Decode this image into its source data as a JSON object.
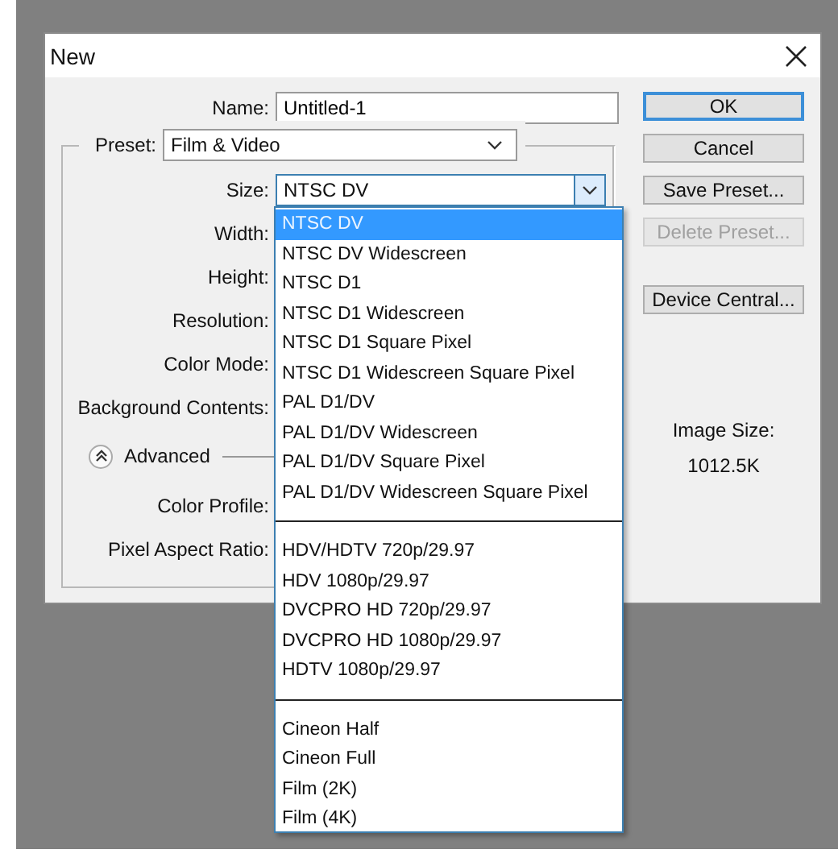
{
  "window": {
    "title": "New"
  },
  "name_field": {
    "label": "Name:",
    "value": "Untitled-1"
  },
  "preset": {
    "label": "Preset:",
    "value": "Film & Video"
  },
  "size": {
    "label": "Size:",
    "value": "NTSC DV",
    "expanded": true
  },
  "field_labels": [
    "Width:",
    "Height:",
    "Resolution:",
    "Color Mode:",
    "Background Contents:"
  ],
  "advanced": {
    "label": "Advanced",
    "expanded": true
  },
  "advanced_labels": [
    "Color Profile:",
    "Pixel Aspect Ratio:"
  ],
  "buttons": [
    {
      "label": "OK",
      "kind": "default",
      "disabled": false
    },
    {
      "label": "Cancel",
      "kind": "normal",
      "disabled": false
    },
    {
      "label": "Save Preset...",
      "kind": "normal",
      "disabled": false
    },
    {
      "label": "Delete Preset...",
      "kind": "normal",
      "disabled": true
    },
    {
      "label": "Device Central...",
      "kind": "spaced",
      "disabled": false
    }
  ],
  "image_size": {
    "label": "Image Size:",
    "value": "1012.5K"
  },
  "size_options": [
    [
      {
        "label": "NTSC DV",
        "selected": true
      },
      {
        "label": "NTSC DV Widescreen",
        "selected": false
      },
      {
        "label": "NTSC D1",
        "selected": false
      },
      {
        "label": "NTSC D1 Widescreen",
        "selected": false
      },
      {
        "label": "NTSC D1 Square Pixel",
        "selected": false
      },
      {
        "label": "NTSC D1 Widescreen Square Pixel",
        "selected": false
      },
      {
        "label": "PAL D1/DV",
        "selected": false
      },
      {
        "label": "PAL D1/DV Widescreen",
        "selected": false
      },
      {
        "label": "PAL D1/DV Square Pixel",
        "selected": false
      },
      {
        "label": "PAL D1/DV Widescreen Square Pixel",
        "selected": false
      }
    ],
    [
      {
        "label": "HDV/HDTV 720p/29.97",
        "selected": false
      },
      {
        "label": "HDV 1080p/29.97",
        "selected": false
      },
      {
        "label": "DVCPRO HD 720p/29.97",
        "selected": false
      },
      {
        "label": "DVCPRO HD 1080p/29.97",
        "selected": false
      },
      {
        "label": "HDTV 1080p/29.97",
        "selected": false
      }
    ],
    [
      {
        "label": "Cineon Half",
        "selected": false
      },
      {
        "label": "Cineon Full",
        "selected": false
      },
      {
        "label": "Film (2K)",
        "selected": false
      },
      {
        "label": "Film (4K)",
        "selected": false
      }
    ]
  ]
}
